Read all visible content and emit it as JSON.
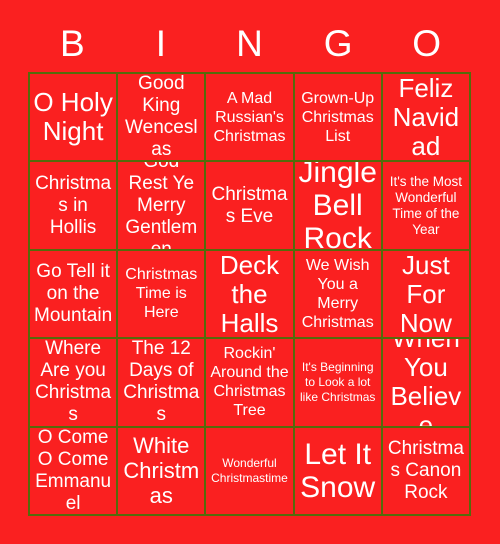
{
  "card": {
    "background_color": "#fa2020",
    "border_color": "#556b0b",
    "text_color": "#ffffff",
    "header_letters": [
      "B",
      "I",
      "N",
      "G",
      "O"
    ],
    "rows": [
      [
        {
          "label": "O Holy Night",
          "size": "xl"
        },
        {
          "label": "Good King Wenceslas",
          "size": "md"
        },
        {
          "label": "A Mad Russian's Christmas",
          "size": "sm"
        },
        {
          "label": "Grown-Up Christmas List",
          "size": "sm"
        },
        {
          "label": "Feliz Navidad",
          "size": "xl"
        }
      ],
      [
        {
          "label": "Christmas in Hollis",
          "size": "md"
        },
        {
          "label": "God Rest Ye Merry Gentlemen",
          "size": "md"
        },
        {
          "label": "Christmas Eve",
          "size": "md"
        },
        {
          "label": "Jingle Bell Rock",
          "size": "xxl"
        },
        {
          "label": "It's the Most Wonderful Time of the Year",
          "size": "xs"
        }
      ],
      [
        {
          "label": "Go Tell it on the Mountain",
          "size": "md"
        },
        {
          "label": "Christmas Time is Here",
          "size": "sm"
        },
        {
          "label": "Deck the Halls",
          "size": "xl"
        },
        {
          "label": "We Wish You a Merry Christmas",
          "size": "sm"
        },
        {
          "label": "Just For Now",
          "size": "xl"
        }
      ],
      [
        {
          "label": "Where Are you Christmas",
          "size": "md"
        },
        {
          "label": "The 12 Days of Christmas",
          "size": "md"
        },
        {
          "label": "Rockin' Around the Christmas Tree",
          "size": "sm"
        },
        {
          "label": "It's Beginning to Look a lot like Christmas",
          "size": "xxs"
        },
        {
          "label": "When You Believe",
          "size": "xl"
        }
      ],
      [
        {
          "label": "O Come O Come Emmanuel",
          "size": "md"
        },
        {
          "label": "White Christmas",
          "size": "lg"
        },
        {
          "label": "Wonderful Christmastime",
          "size": "xxs"
        },
        {
          "label": "Let It Snow",
          "size": "xxl"
        },
        {
          "label": "Christmas Canon Rock",
          "size": "md"
        }
      ]
    ]
  }
}
